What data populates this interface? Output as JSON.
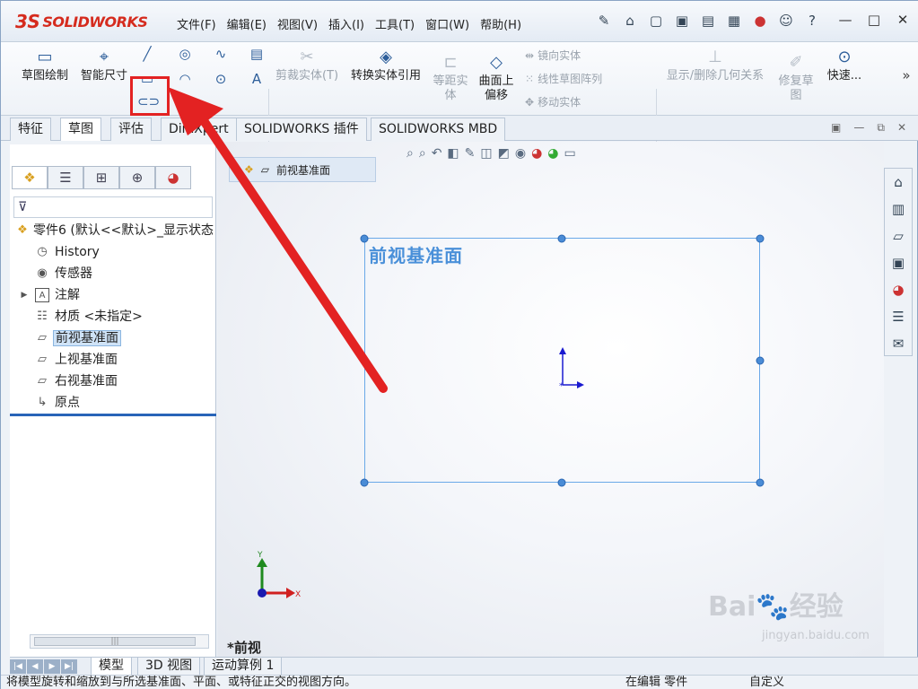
{
  "app": {
    "logo_text": "SOLIDWORKS",
    "logo_mark": "3S"
  },
  "menu": [
    "文件(F)",
    "编辑(E)",
    "视图(V)",
    "插入(I)",
    "工具(T)",
    "窗口(W)",
    "帮助(H)"
  ],
  "quick_toolbar_icons": [
    "pin-icon",
    "home-icon",
    "new-document-icon",
    "open-icon",
    "save-icon",
    "print-icon",
    "traffic-light-icon",
    "user-icon",
    "help-icon"
  ],
  "ribbon": {
    "sketch": "草图绘制",
    "smart_dim": "智能尺寸",
    "trim": "剪裁实体(T)",
    "convert": "转换实体引用",
    "offset": "等距实体",
    "surface_offset": "曲面上偏移",
    "mirror": "镜向实体",
    "linear_pattern": "线性草图阵列",
    "move": "移动实体",
    "show_relations": "显示/删除几何关系",
    "repair": "修复草图",
    "quick": "快速..."
  },
  "tabs": [
    "特征",
    "草图",
    "评估",
    "DimXpert",
    "SOLIDWORKS 插件",
    "SOLIDWORKS MBD"
  ],
  "active_tab": "草图",
  "tree": {
    "root": "零件6 (默认<<默认>_显示状态",
    "items": [
      "History",
      "传感器",
      "注解",
      "材质 <未指定>",
      "前视基准面",
      "上视基准面",
      "右视基准面",
      "原点"
    ]
  },
  "breadcrumb": "前视基准面",
  "plane_label": "前视基准面",
  "view_label": "*前视",
  "axes": {
    "x": "X",
    "y": "Y"
  },
  "bottom_tabs": [
    "模型",
    "3D 视图",
    "运动算例 1"
  ],
  "status": {
    "message": "将模型旋转和缩放到与所选基准面、平面、或特征正交的视图方向。",
    "editing": "在编辑 零件",
    "custom": "自定义"
  },
  "watermark": {
    "brand": "Bai",
    "cn": "经验",
    "url": "jingyan.baidu.com"
  },
  "colors": {
    "highlight_box": "#e32222",
    "arrow": "#e32222",
    "plane": "#6aa9e8",
    "plane_label": "#4a90d9"
  }
}
